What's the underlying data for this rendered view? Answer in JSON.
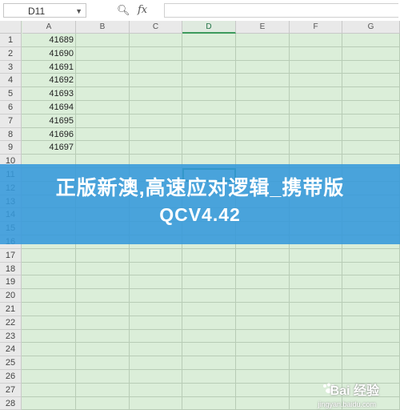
{
  "formula_bar": {
    "namebox": "D11",
    "search_icon": "zoom-icon",
    "fx_label": "fx",
    "input_value": ""
  },
  "columns": [
    "A",
    "B",
    "C",
    "D",
    "E",
    "F",
    "G"
  ],
  "selected_column": "D",
  "rows": [
    "1",
    "2",
    "3",
    "4",
    "5",
    "6",
    "7",
    "8",
    "9",
    "10",
    "11",
    "12",
    "13",
    "14",
    "15",
    "16",
    "17",
    "18",
    "19",
    "20",
    "21",
    "22",
    "23",
    "24",
    "25",
    "26",
    "27",
    "28"
  ],
  "cells_A": [
    "41689",
    "41690",
    "41691",
    "41692",
    "41693",
    "41694",
    "41695",
    "41696",
    "41697"
  ],
  "banner": {
    "line1": "正版新澳,高速应对逻辑_携带版",
    "line2": "QCV4.42"
  },
  "watermark": {
    "brand": "Bai 经验",
    "url": "jingyan.baidu.com"
  },
  "colors": {
    "grid_bg": "#dbeed9",
    "banner": "#3498db",
    "active_border": "#2e8b57"
  }
}
